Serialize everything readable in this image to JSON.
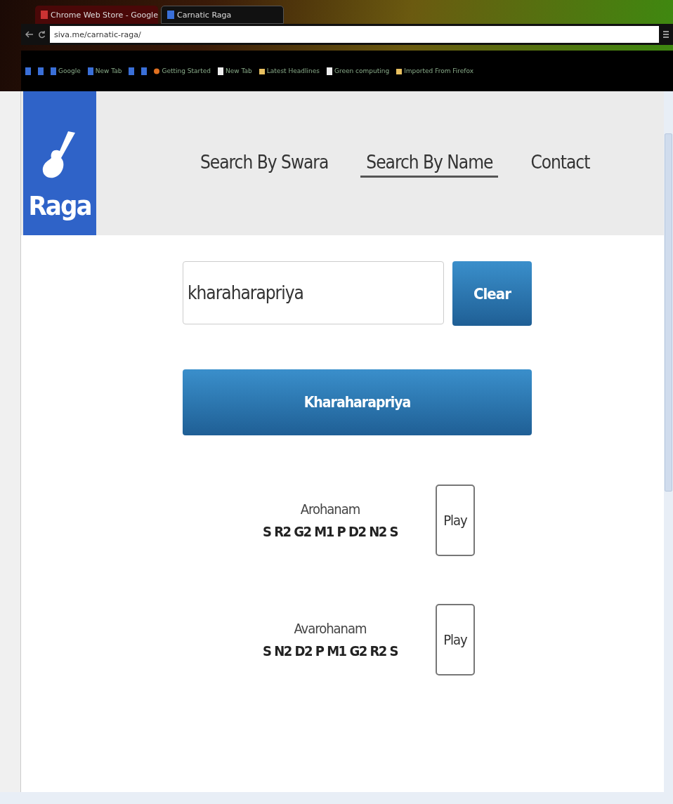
{
  "browser": {
    "tabs": [
      {
        "title": "Chrome Web Store - Google",
        "selected": false
      },
      {
        "title": "Carnatic Raga",
        "selected": true
      }
    ],
    "address": "siva.me/carnatic-raga/",
    "bookmarks": [
      {
        "kind": "page"
      },
      {
        "kind": "page"
      },
      {
        "label": "Google",
        "kind": "page"
      },
      {
        "label": "New Tab",
        "kind": "page"
      },
      {
        "kind": "page"
      },
      {
        "kind": "page"
      },
      {
        "label": "Getting Started",
        "kind": "firefox"
      },
      {
        "label": "New Tab",
        "kind": "doc"
      },
      {
        "label": "Latest Headlines",
        "kind": "folder"
      },
      {
        "label": "Green computing",
        "kind": "doc"
      },
      {
        "label": "Imported From Firefox",
        "kind": "folder"
      }
    ]
  },
  "logo": {
    "text": "Raga"
  },
  "nav": [
    {
      "label": "Search By Swara",
      "selected": false
    },
    {
      "label": "Search By Name",
      "selected": true
    },
    {
      "label": "Contact",
      "selected": false
    }
  ],
  "search": {
    "value": "kharaharapriya",
    "clear_button": "Clear"
  },
  "result": {
    "label": "Kharaharapriya"
  },
  "scales": [
    {
      "title": "Arohanam",
      "notes": "S R2 G2 M1 P D2 N2 S",
      "button": "Play"
    },
    {
      "title": "Avarohanam",
      "notes": "S N2 D2 P M1 G2 R2 S",
      "button": "Play"
    }
  ]
}
